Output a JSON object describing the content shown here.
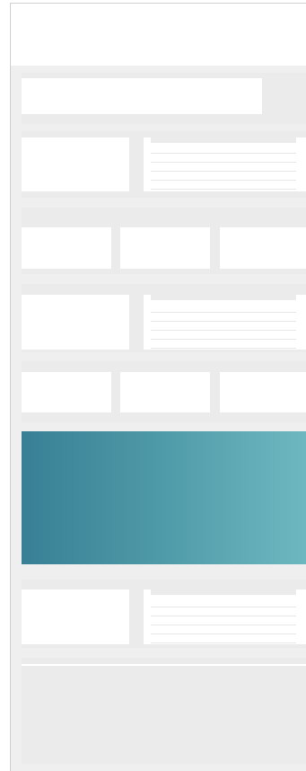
{
  "screen": {
    "header": {},
    "sections": [
      {
        "type": "banner"
      },
      {
        "type": "media-text"
      },
      {
        "type": "card-row",
        "cards": 3
      },
      {
        "type": "media-text"
      },
      {
        "type": "card-row",
        "cards": 3
      },
      {
        "type": "hero",
        "colors": {
          "start": "#387f95",
          "end": "#6db8c0"
        }
      },
      {
        "type": "media-text"
      },
      {
        "type": "large-block"
      }
    ]
  }
}
